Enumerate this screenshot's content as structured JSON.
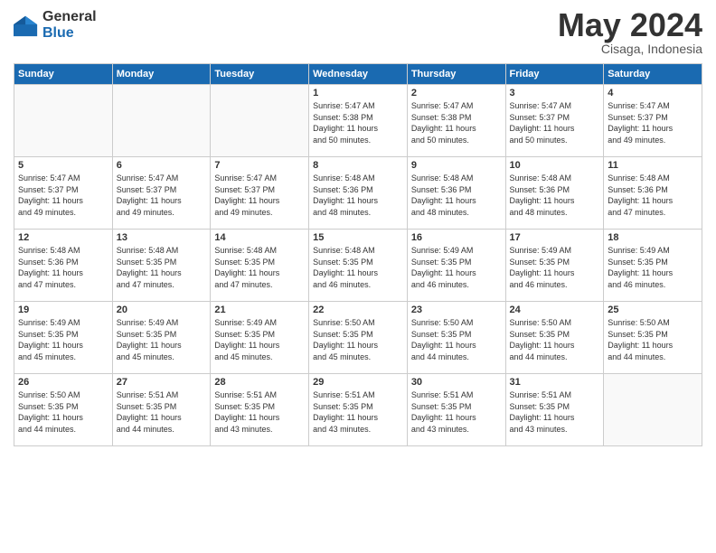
{
  "header": {
    "logo_general": "General",
    "logo_blue": "Blue",
    "month": "May 2024",
    "location": "Cisaga, Indonesia"
  },
  "weekdays": [
    "Sunday",
    "Monday",
    "Tuesday",
    "Wednesday",
    "Thursday",
    "Friday",
    "Saturday"
  ],
  "weeks": [
    [
      {
        "day": "",
        "info": ""
      },
      {
        "day": "",
        "info": ""
      },
      {
        "day": "",
        "info": ""
      },
      {
        "day": "1",
        "info": "Sunrise: 5:47 AM\nSunset: 5:38 PM\nDaylight: 11 hours\nand 50 minutes."
      },
      {
        "day": "2",
        "info": "Sunrise: 5:47 AM\nSunset: 5:38 PM\nDaylight: 11 hours\nand 50 minutes."
      },
      {
        "day": "3",
        "info": "Sunrise: 5:47 AM\nSunset: 5:37 PM\nDaylight: 11 hours\nand 50 minutes."
      },
      {
        "day": "4",
        "info": "Sunrise: 5:47 AM\nSunset: 5:37 PM\nDaylight: 11 hours\nand 49 minutes."
      }
    ],
    [
      {
        "day": "5",
        "info": "Sunrise: 5:47 AM\nSunset: 5:37 PM\nDaylight: 11 hours\nand 49 minutes."
      },
      {
        "day": "6",
        "info": "Sunrise: 5:47 AM\nSunset: 5:37 PM\nDaylight: 11 hours\nand 49 minutes."
      },
      {
        "day": "7",
        "info": "Sunrise: 5:47 AM\nSunset: 5:37 PM\nDaylight: 11 hours\nand 49 minutes."
      },
      {
        "day": "8",
        "info": "Sunrise: 5:48 AM\nSunset: 5:36 PM\nDaylight: 11 hours\nand 48 minutes."
      },
      {
        "day": "9",
        "info": "Sunrise: 5:48 AM\nSunset: 5:36 PM\nDaylight: 11 hours\nand 48 minutes."
      },
      {
        "day": "10",
        "info": "Sunrise: 5:48 AM\nSunset: 5:36 PM\nDaylight: 11 hours\nand 48 minutes."
      },
      {
        "day": "11",
        "info": "Sunrise: 5:48 AM\nSunset: 5:36 PM\nDaylight: 11 hours\nand 47 minutes."
      }
    ],
    [
      {
        "day": "12",
        "info": "Sunrise: 5:48 AM\nSunset: 5:36 PM\nDaylight: 11 hours\nand 47 minutes."
      },
      {
        "day": "13",
        "info": "Sunrise: 5:48 AM\nSunset: 5:35 PM\nDaylight: 11 hours\nand 47 minutes."
      },
      {
        "day": "14",
        "info": "Sunrise: 5:48 AM\nSunset: 5:35 PM\nDaylight: 11 hours\nand 47 minutes."
      },
      {
        "day": "15",
        "info": "Sunrise: 5:48 AM\nSunset: 5:35 PM\nDaylight: 11 hours\nand 46 minutes."
      },
      {
        "day": "16",
        "info": "Sunrise: 5:49 AM\nSunset: 5:35 PM\nDaylight: 11 hours\nand 46 minutes."
      },
      {
        "day": "17",
        "info": "Sunrise: 5:49 AM\nSunset: 5:35 PM\nDaylight: 11 hours\nand 46 minutes."
      },
      {
        "day": "18",
        "info": "Sunrise: 5:49 AM\nSunset: 5:35 PM\nDaylight: 11 hours\nand 46 minutes."
      }
    ],
    [
      {
        "day": "19",
        "info": "Sunrise: 5:49 AM\nSunset: 5:35 PM\nDaylight: 11 hours\nand 45 minutes."
      },
      {
        "day": "20",
        "info": "Sunrise: 5:49 AM\nSunset: 5:35 PM\nDaylight: 11 hours\nand 45 minutes."
      },
      {
        "day": "21",
        "info": "Sunrise: 5:49 AM\nSunset: 5:35 PM\nDaylight: 11 hours\nand 45 minutes."
      },
      {
        "day": "22",
        "info": "Sunrise: 5:50 AM\nSunset: 5:35 PM\nDaylight: 11 hours\nand 45 minutes."
      },
      {
        "day": "23",
        "info": "Sunrise: 5:50 AM\nSunset: 5:35 PM\nDaylight: 11 hours\nand 44 minutes."
      },
      {
        "day": "24",
        "info": "Sunrise: 5:50 AM\nSunset: 5:35 PM\nDaylight: 11 hours\nand 44 minutes."
      },
      {
        "day": "25",
        "info": "Sunrise: 5:50 AM\nSunset: 5:35 PM\nDaylight: 11 hours\nand 44 minutes."
      }
    ],
    [
      {
        "day": "26",
        "info": "Sunrise: 5:50 AM\nSunset: 5:35 PM\nDaylight: 11 hours\nand 44 minutes."
      },
      {
        "day": "27",
        "info": "Sunrise: 5:51 AM\nSunset: 5:35 PM\nDaylight: 11 hours\nand 44 minutes."
      },
      {
        "day": "28",
        "info": "Sunrise: 5:51 AM\nSunset: 5:35 PM\nDaylight: 11 hours\nand 43 minutes."
      },
      {
        "day": "29",
        "info": "Sunrise: 5:51 AM\nSunset: 5:35 PM\nDaylight: 11 hours\nand 43 minutes."
      },
      {
        "day": "30",
        "info": "Sunrise: 5:51 AM\nSunset: 5:35 PM\nDaylight: 11 hours\nand 43 minutes."
      },
      {
        "day": "31",
        "info": "Sunrise: 5:51 AM\nSunset: 5:35 PM\nDaylight: 11 hours\nand 43 minutes."
      },
      {
        "day": "",
        "info": ""
      }
    ]
  ]
}
